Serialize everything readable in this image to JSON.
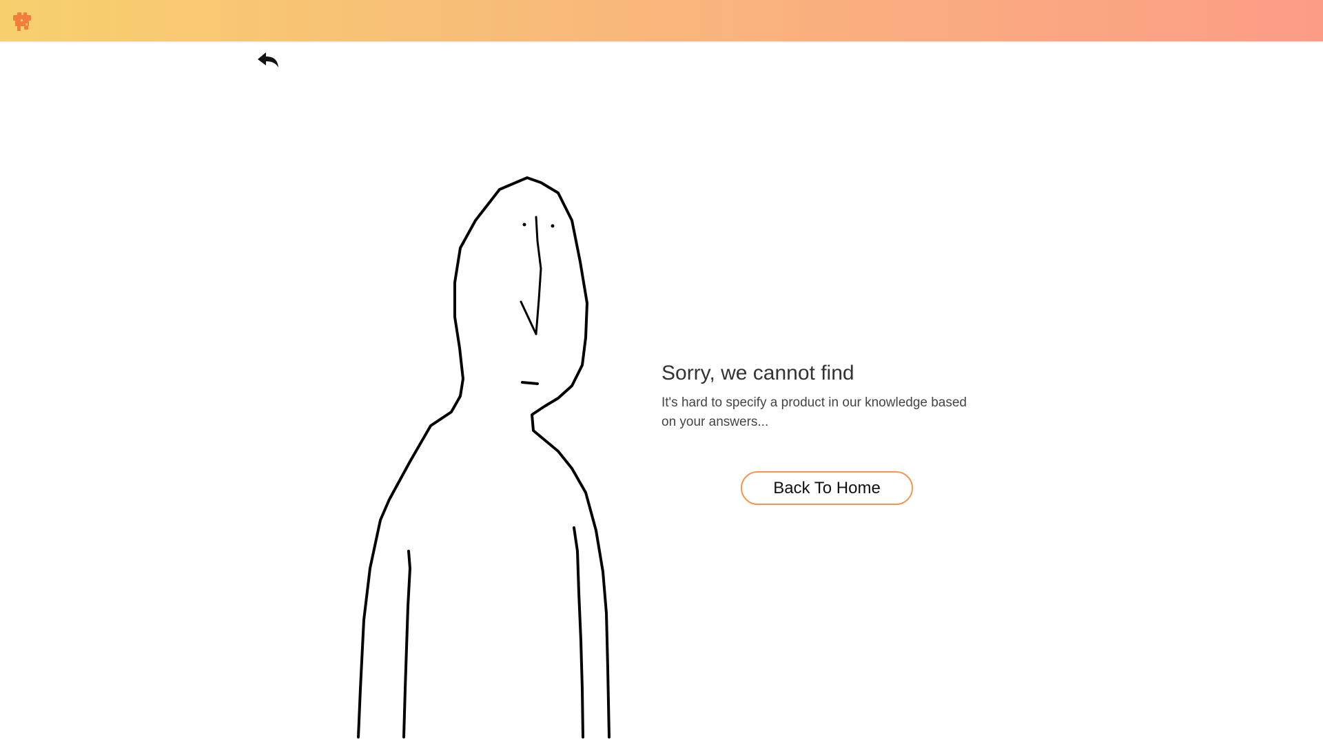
{
  "header": {
    "logo_icon": "puzzle-piece-icon",
    "background_gradient": [
      "#f7d06e",
      "#fc9c86"
    ],
    "logo_color": "#f47c3c"
  },
  "nav": {
    "back_icon": "reply-arrow-icon"
  },
  "illustration": {
    "icon": "sad-person-drawing"
  },
  "message": {
    "title": "Sorry, we cannot find",
    "description": "It's hard to specify a product in our knowledge based on your answers..."
  },
  "actions": {
    "home_label": "Back To Home",
    "accent_color": "#f7944f"
  }
}
